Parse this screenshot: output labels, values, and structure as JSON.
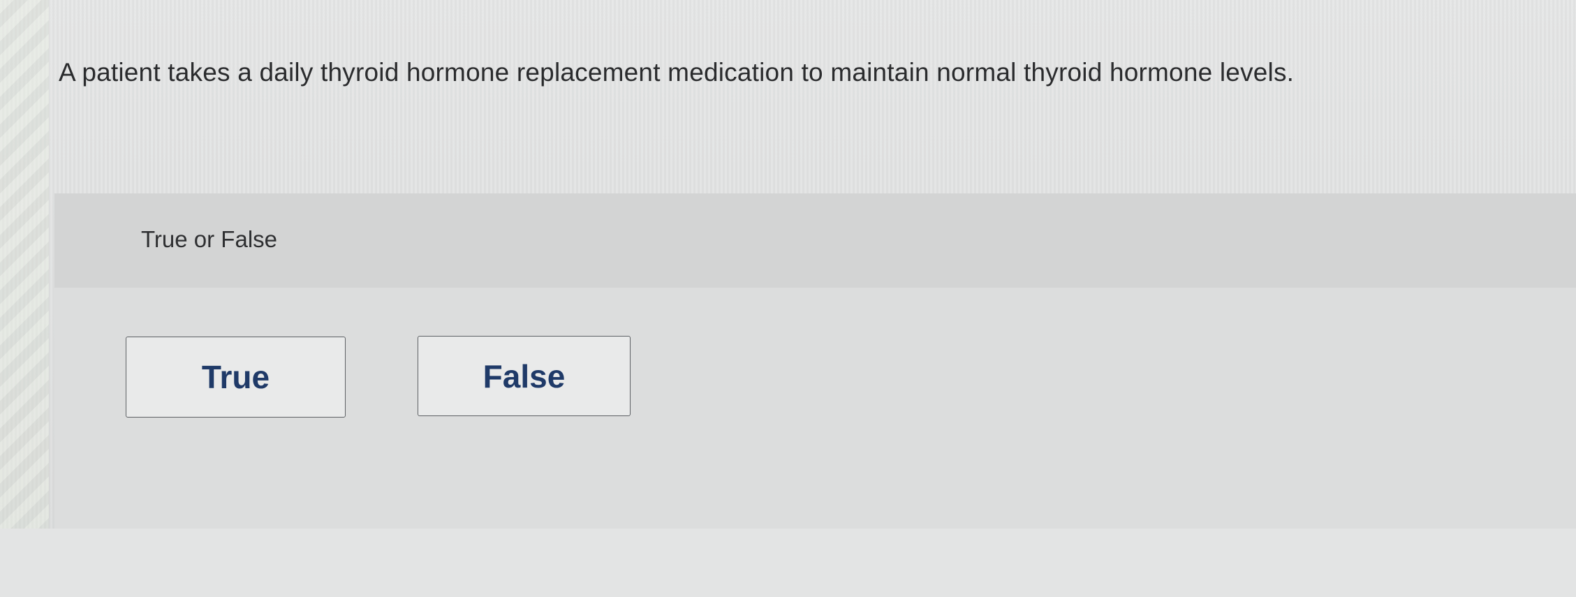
{
  "question": {
    "text": "A patient takes a daily thyroid hormone replacement medication to maintain normal thyroid hormone levels."
  },
  "prompt": {
    "label": "True or False"
  },
  "answers": {
    "true_label": "True",
    "false_label": "False"
  },
  "colors": {
    "button_text": "#1f3a68",
    "button_border": "#5d6064",
    "prompt_band": "#d3d4d4"
  }
}
